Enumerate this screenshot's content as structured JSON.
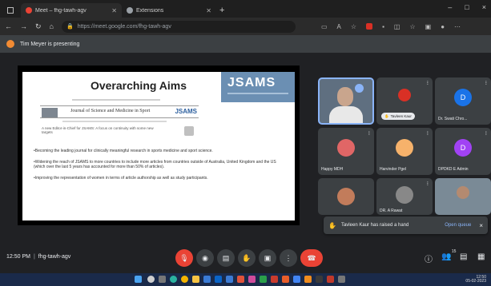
{
  "browser": {
    "tabs": [
      {
        "label": "Meet – fhg-tawh-agv",
        "favicon_color": "#ea4335",
        "active": true
      },
      {
        "label": "Extensions",
        "favicon_color": "#9aa0a6",
        "active": false
      }
    ],
    "new_tab": "+",
    "window_controls": [
      "–",
      "□",
      "×"
    ],
    "url": "https://meet.google.com/fhg-tawh-agv"
  },
  "presenting_banner": "Tim Meyer is presenting",
  "slide": {
    "title": "Overarching Aims",
    "logo": "JSAMS",
    "journal_name": "Journal of Science and Medicine in Sport",
    "journal_logo": "JSAMS",
    "citation": "A new Editor-in-Chief for JSAMS: A focus on continuity with some new targets",
    "bullets": [
      "•Becoming the leading journal for clinically meaningful research in sports medicine and sport science.",
      "•Widening the reach of JSAMS to more countries to include more articles from countries outside of Australia, United Kingdom and the US (which over the last 5 years has accounted for more than 50% of articles).",
      "•Improving the representation of women in terms of article authorship as well as study participants."
    ]
  },
  "participants": [
    {
      "name": "",
      "type": "video"
    },
    {
      "name": "Tavleen Kaur",
      "type": "pill",
      "avatar_color": "#d93025"
    },
    {
      "name": "Dr. Swati Chro...",
      "type": "avatar",
      "initial": "D",
      "avatar_color": "#1a73e8"
    },
    {
      "name": "Happy MDH",
      "type": "avatar",
      "initial": "",
      "avatar_color": "#e06666"
    },
    {
      "name": "Harvinder Pgel",
      "type": "avatar",
      "initial": "",
      "avatar_color": "#f6b26b"
    },
    {
      "name": "DPDKD E Admin",
      "type": "avatar",
      "initial": "D",
      "avatar_color": "#a142f4"
    },
    {
      "name": "",
      "type": "avatar",
      "initial": "",
      "avatar_color": "#c27c5b"
    },
    {
      "name": "DR. A Rawat",
      "type": "avatar",
      "initial": "",
      "avatar_color": "#888888"
    },
    {
      "name": "",
      "type": "video2"
    }
  ],
  "toast": {
    "message": "Tavleen Kaur has raised a hand",
    "action": "Open queue",
    "close": "×"
  },
  "meeting": {
    "time": "12:50 PM",
    "code": "fhg-tawh-agv",
    "participant_count": "15"
  },
  "taskbar": {
    "time": "12:50",
    "date": "05-02-2023"
  }
}
